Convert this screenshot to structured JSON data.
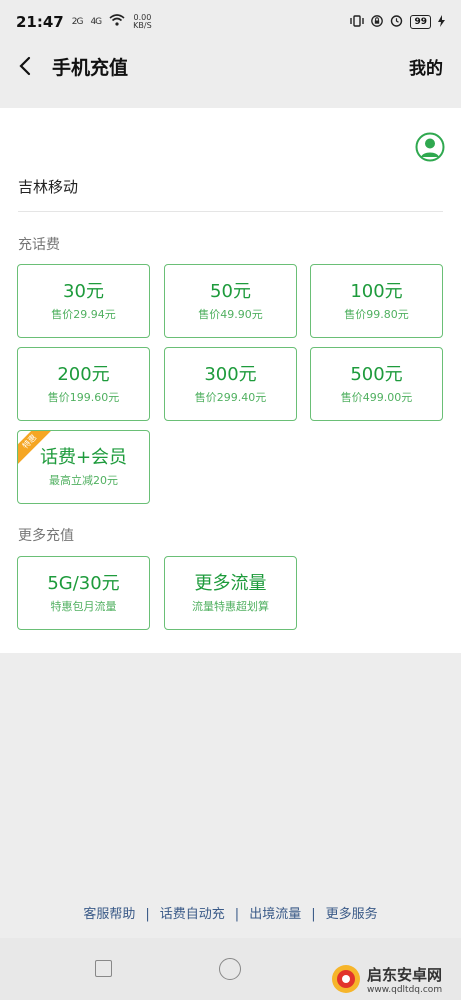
{
  "status_bar": {
    "time": "21:47",
    "signal_a": "2G",
    "signal_b": "4G",
    "speed": "0.00",
    "speed_unit": "KB/S",
    "battery": "99"
  },
  "nav": {
    "title": "手机充值",
    "right_label": "我的"
  },
  "account": {
    "carrier": "吉林移动"
  },
  "recharge": {
    "title": "充话费",
    "items": [
      {
        "main": "30元",
        "sub": "售价29.94元"
      },
      {
        "main": "50元",
        "sub": "售价49.90元"
      },
      {
        "main": "100元",
        "sub": "售价99.80元"
      },
      {
        "main": "200元",
        "sub": "售价199.60元"
      },
      {
        "main": "300元",
        "sub": "售价299.40元"
      },
      {
        "main": "500元",
        "sub": "售价499.00元"
      },
      {
        "main": "话费+会员",
        "sub": "最高立减20元",
        "badge": "特惠"
      }
    ]
  },
  "more": {
    "title": "更多充值",
    "items": [
      {
        "main": "5G/30元",
        "sub": "特惠包月流量"
      },
      {
        "main": "更多流量",
        "sub": "流量特惠超划算"
      }
    ]
  },
  "footer": {
    "links": [
      "客服帮助",
      "话费自动充",
      "出境流量",
      "更多服务"
    ]
  },
  "watermark": {
    "title": "启东安卓网",
    "url": "www.qdltdq.com"
  },
  "colors": {
    "accent": "#1e9b3c",
    "tile_border": "#6abf76",
    "badge": "#f5a623",
    "link": "#3a5a88"
  }
}
